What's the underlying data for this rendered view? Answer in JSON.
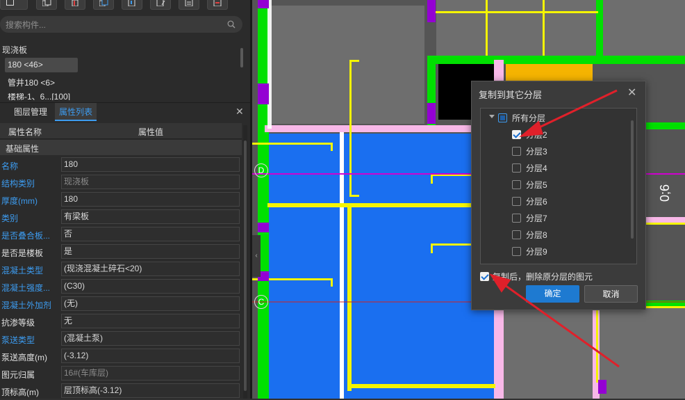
{
  "search": {
    "placeholder": "搜索构件..."
  },
  "components": {
    "title": "现浇板",
    "items": [
      "180 <46>",
      "管井180 <6>",
      "楼梯-1、6...[100]"
    ]
  },
  "panel": {
    "tabs": [
      "图层管理",
      "属性列表"
    ],
    "headers": [
      "属性名称",
      "属性值"
    ],
    "group": "基础属性",
    "rows": [
      {
        "name": "名称",
        "value": "180",
        "name_blue": true,
        "dim": false
      },
      {
        "name": "结构类别",
        "value": "现浇板",
        "name_blue": true,
        "dim": true
      },
      {
        "name": "厚度(mm)",
        "value": "180",
        "name_blue": true,
        "dim": false
      },
      {
        "name": "类别",
        "value": "有梁板",
        "name_blue": true,
        "dim": false
      },
      {
        "name": "是否叠合板...",
        "value": "否",
        "name_blue": true,
        "dim": false
      },
      {
        "name": "是否是楼板",
        "value": "是",
        "name_blue": false,
        "dim": false
      },
      {
        "name": "混凝土类型",
        "value": "(现浇混凝土碎石<20)",
        "name_blue": true,
        "dim": false
      },
      {
        "name": "混凝土强度...",
        "value": "(C30)",
        "name_blue": true,
        "dim": false
      },
      {
        "name": "混凝土外加剂",
        "value": "(无)",
        "name_blue": true,
        "dim": false
      },
      {
        "name": "抗渗等级",
        "value": "无",
        "name_blue": false,
        "dim": false
      },
      {
        "name": "泵送类型",
        "value": "(混凝土泵)",
        "name_blue": true,
        "dim": false
      },
      {
        "name": "泵送高度(m)",
        "value": "(-3.12)",
        "name_blue": false,
        "dim": false
      },
      {
        "name": "图元归属",
        "value": "16#(车库层)",
        "name_blue": false,
        "dim": true
      },
      {
        "name": "顶标高(m)",
        "value": "层顶标高(-3.12)",
        "name_blue": false,
        "dim": false
      }
    ]
  },
  "canvas": {
    "axis_labels": [
      "D",
      "C"
    ],
    "dimension_text": "0;6"
  },
  "dialog": {
    "title": "复制到其它分层",
    "root": {
      "label": "所有分层",
      "state": "partial"
    },
    "layers": [
      {
        "label": "分层2",
        "checked": true
      },
      {
        "label": "分层3",
        "checked": false
      },
      {
        "label": "分层4",
        "checked": false
      },
      {
        "label": "分层5",
        "checked": false
      },
      {
        "label": "分层6",
        "checked": false
      },
      {
        "label": "分层7",
        "checked": false
      },
      {
        "label": "分层8",
        "checked": false
      },
      {
        "label": "分层9",
        "checked": false
      }
    ],
    "option": {
      "label": "复制后，删除原分层的图元",
      "checked": true
    },
    "ok": "确定",
    "cancel": "取消"
  },
  "colors": {
    "accent": "#3d9cf0",
    "ok_button": "#1e7ad1",
    "annotation_arrow": "#e0202a",
    "slab_blue": "#1a6ff0",
    "beam_green": "#00e000",
    "wall_yellow": "#f5f500",
    "wall_pink": "#f8b8e8",
    "column_purple": "#9400d3",
    "column_orange": "#f5b400"
  }
}
